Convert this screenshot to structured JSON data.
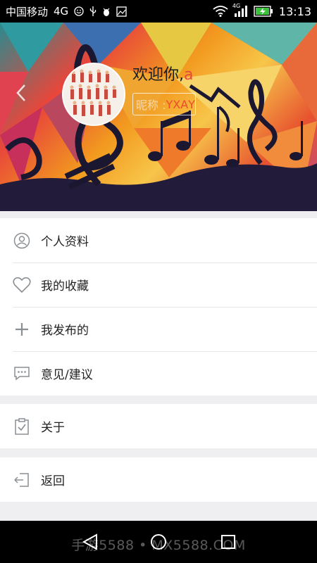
{
  "status_bar": {
    "carrier": "中国移动",
    "network": "4G",
    "network_small": "4G",
    "time": "13:13"
  },
  "profile": {
    "welcome_prefix": "欢迎你,",
    "username": "a",
    "nickname_label": "昵称 : ",
    "nickname_value": "ΥΧΑΥ"
  },
  "menu": {
    "items": [
      {
        "label": "个人资料",
        "icon": "user-circle-icon"
      },
      {
        "label": "我的收藏",
        "icon": "heart-icon"
      },
      {
        "label": "我发布的",
        "icon": "plus-icon"
      },
      {
        "label": "意见/建议",
        "icon": "chat-bubble-icon"
      },
      {
        "label": "关于",
        "icon": "clipboard-check-icon"
      },
      {
        "label": "返回",
        "icon": "exit-icon"
      }
    ]
  },
  "watermark": "手游5588 • MX5588.COM",
  "colors": {
    "accent": "#e9473a",
    "icon_gray": "#8a8f94"
  }
}
